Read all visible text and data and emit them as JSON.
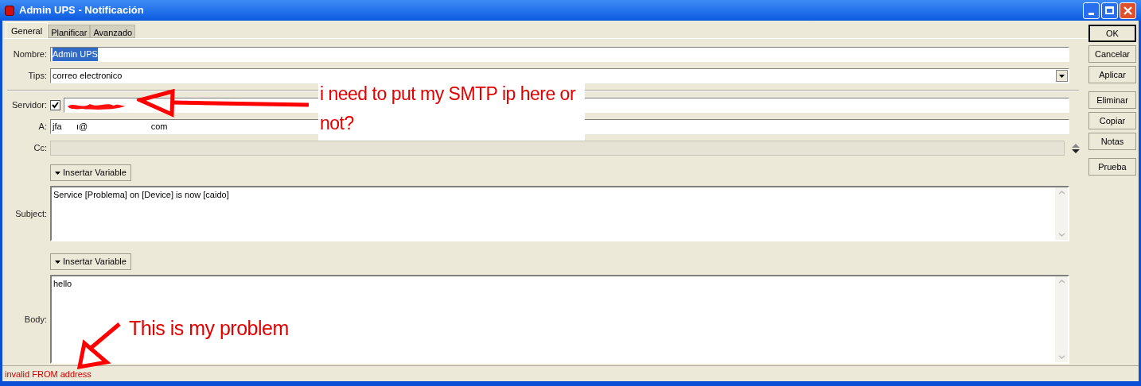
{
  "window": {
    "title": "Admin UPS - Notificación"
  },
  "tabs": [
    {
      "label": "General",
      "selected": true
    },
    {
      "label": "Planificar",
      "selected": false
    },
    {
      "label": "Avanzado",
      "selected": false
    }
  ],
  "fields": [
    {
      "kind": "text",
      "label": "Nombre:",
      "value": "Admin UPS",
      "selected": true
    },
    {
      "kind": "dropdown",
      "label": "Tips:",
      "value": "correo electronico"
    },
    {
      "kind": "separator"
    },
    {
      "kind": "check",
      "label": "Servidor:",
      "checked": true
    },
    {
      "kind": "text",
      "label": "A:",
      "value": "jfa      ı@                          com",
      "selected": false
    },
    {
      "kind": "disabled",
      "label": "Cc:"
    }
  ],
  "subject": {
    "label": "Subject:",
    "insert_button": "Insertar Variable",
    "value": "Service [Problema] on [Device] is now [caido]"
  },
  "body": {
    "label": "Body:",
    "insert_button": "Insertar Variable",
    "value": "hello"
  },
  "button_groups": [
    [
      {
        "label": "OK",
        "default": true
      },
      {
        "label": "Cancelar",
        "default": false
      },
      {
        "label": "Aplicar",
        "default": false
      }
    ],
    [
      {
        "label": "Eliminar",
        "default": false
      },
      {
        "label": "Copiar",
        "default": false
      },
      {
        "label": "Notas",
        "default": false
      }
    ],
    [
      {
        "label": "Prueba",
        "default": false
      }
    ]
  ],
  "status_bar": {
    "text": "invalid FROM address"
  },
  "annotations": [
    {
      "text": "i need to put my SMTP ip here or not?"
    },
    {
      "text": "This is my problem"
    }
  ]
}
